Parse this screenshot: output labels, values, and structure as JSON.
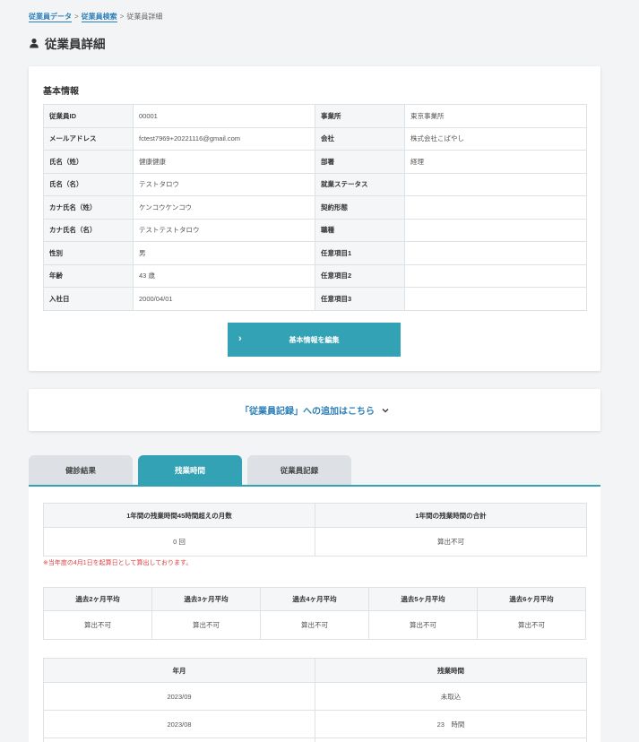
{
  "breadcrumb": {
    "items": [
      "従業員データ",
      "従業員検索"
    ],
    "current": "従業員詳細",
    "separator": ">"
  },
  "page": {
    "title": "従業員詳細",
    "icon": "person-icon"
  },
  "basic_info": {
    "title": "基本情報",
    "rows": [
      {
        "label1": "従業員ID",
        "value1": "00001",
        "label2": "事業所",
        "value2": "東京事業所"
      },
      {
        "label1": "メールアドレス",
        "value1": "fctest7969+20221116@gmail.com",
        "label2": "会社",
        "value2": "株式会社こばやし"
      },
      {
        "label1": "氏名（姓）",
        "value1": "健康健康",
        "label2": "部署",
        "value2": "経理"
      },
      {
        "label1": "氏名（名）",
        "value1": "テストタロウ",
        "label2": "就業ステータス",
        "value2": ""
      },
      {
        "label1": "カナ氏名（姓）",
        "value1": "ケンコウケンコウ",
        "label2": "契約形態",
        "value2": ""
      },
      {
        "label1": "カナ氏名（名）",
        "value1": "テストテストタロウ",
        "label2": "職種",
        "value2": ""
      },
      {
        "label1": "性別",
        "value1": "男",
        "label2": "任意項目1",
        "value2": ""
      },
      {
        "label1": "年齢",
        "value1": "43 歳",
        "label2": "任意項目2",
        "value2": ""
      },
      {
        "label1": "入社日",
        "value1": "2000/04/01",
        "label2": "任意項目3",
        "value2": ""
      }
    ],
    "edit_button": "基本情報を編集"
  },
  "record_link": "「従業員記録」への追加はこちら",
  "tabs": [
    {
      "label": "健診結果",
      "active": false
    },
    {
      "label": "残業時間",
      "active": true
    },
    {
      "label": "従業員記録",
      "active": false
    }
  ],
  "overtime": {
    "summary_headers": [
      "1年間の残業時間45時間超えの月数",
      "1年間の残業時間の合計"
    ],
    "summary_values": [
      "0 回",
      "算出不可"
    ],
    "note": "※当年度の4月1日を起算日として算出しております。",
    "avg_headers": [
      "過去2ヶ月平均",
      "過去3ヶ月平均",
      "過去4ヶ月平均",
      "過去5ヶ月平均",
      "過去6ヶ月平均"
    ],
    "avg_values": [
      "算出不可",
      "算出不可",
      "算出不可",
      "算出不可",
      "算出不可"
    ],
    "monthly_headers": [
      "年月",
      "残業時間"
    ],
    "monthly_rows": [
      {
        "month": "2023/09",
        "hours": "未取込"
      },
      {
        "month": "2023/08",
        "hours": "23　時間"
      },
      {
        "month": "",
        "hours": ""
      }
    ]
  },
  "colors": {
    "accent": "#33a2b4",
    "link": "#2b7fb8",
    "note": "#e04040"
  }
}
